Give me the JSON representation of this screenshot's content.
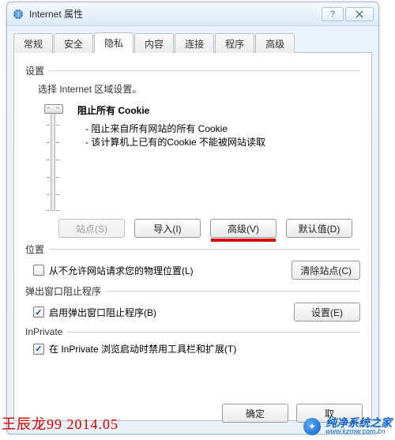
{
  "window": {
    "title": "Internet 属性"
  },
  "tabs": {
    "items": [
      "常规",
      "安全",
      "隐私",
      "内容",
      "连接",
      "程序",
      "高级"
    ],
    "activeIndex": 2
  },
  "settings": {
    "header": "设置",
    "chooseZone": "选择 Internet 区域设置。",
    "levelTitle": "阻止所有 Cookie",
    "bullets": [
      "- 阻止来自所有网站的所有 Cookie",
      "- 该计算机上已有的Cookie 不能被网站读取"
    ],
    "buttons": {
      "sites": "站点(S)",
      "import": "导入(I)",
      "advanced": "高级(V)",
      "default": "默认值(D)"
    }
  },
  "location": {
    "header": "位置",
    "checkboxLabel": "从不允许网站请求您的物理位置(L)",
    "checked": false,
    "clearSites": "清除站点(C)"
  },
  "popup": {
    "header": "弹出窗口阻止程序",
    "checkboxLabel": "启用弹出窗口阻止程序(B)",
    "checked": true,
    "settings": "设置(E)"
  },
  "inprivate": {
    "header": "InPrivate",
    "checkboxLabel": "在 InPrivate 浏览启动时禁用工具栏和扩展(T)",
    "checked": true
  },
  "dialogButtons": {
    "ok": "确定",
    "cancel": "取"
  },
  "watermark": {
    "left": "王辰龙99 2014.05",
    "rightText": "纯净系统之家",
    "rightSub": "www.kzmw.com.cn"
  }
}
